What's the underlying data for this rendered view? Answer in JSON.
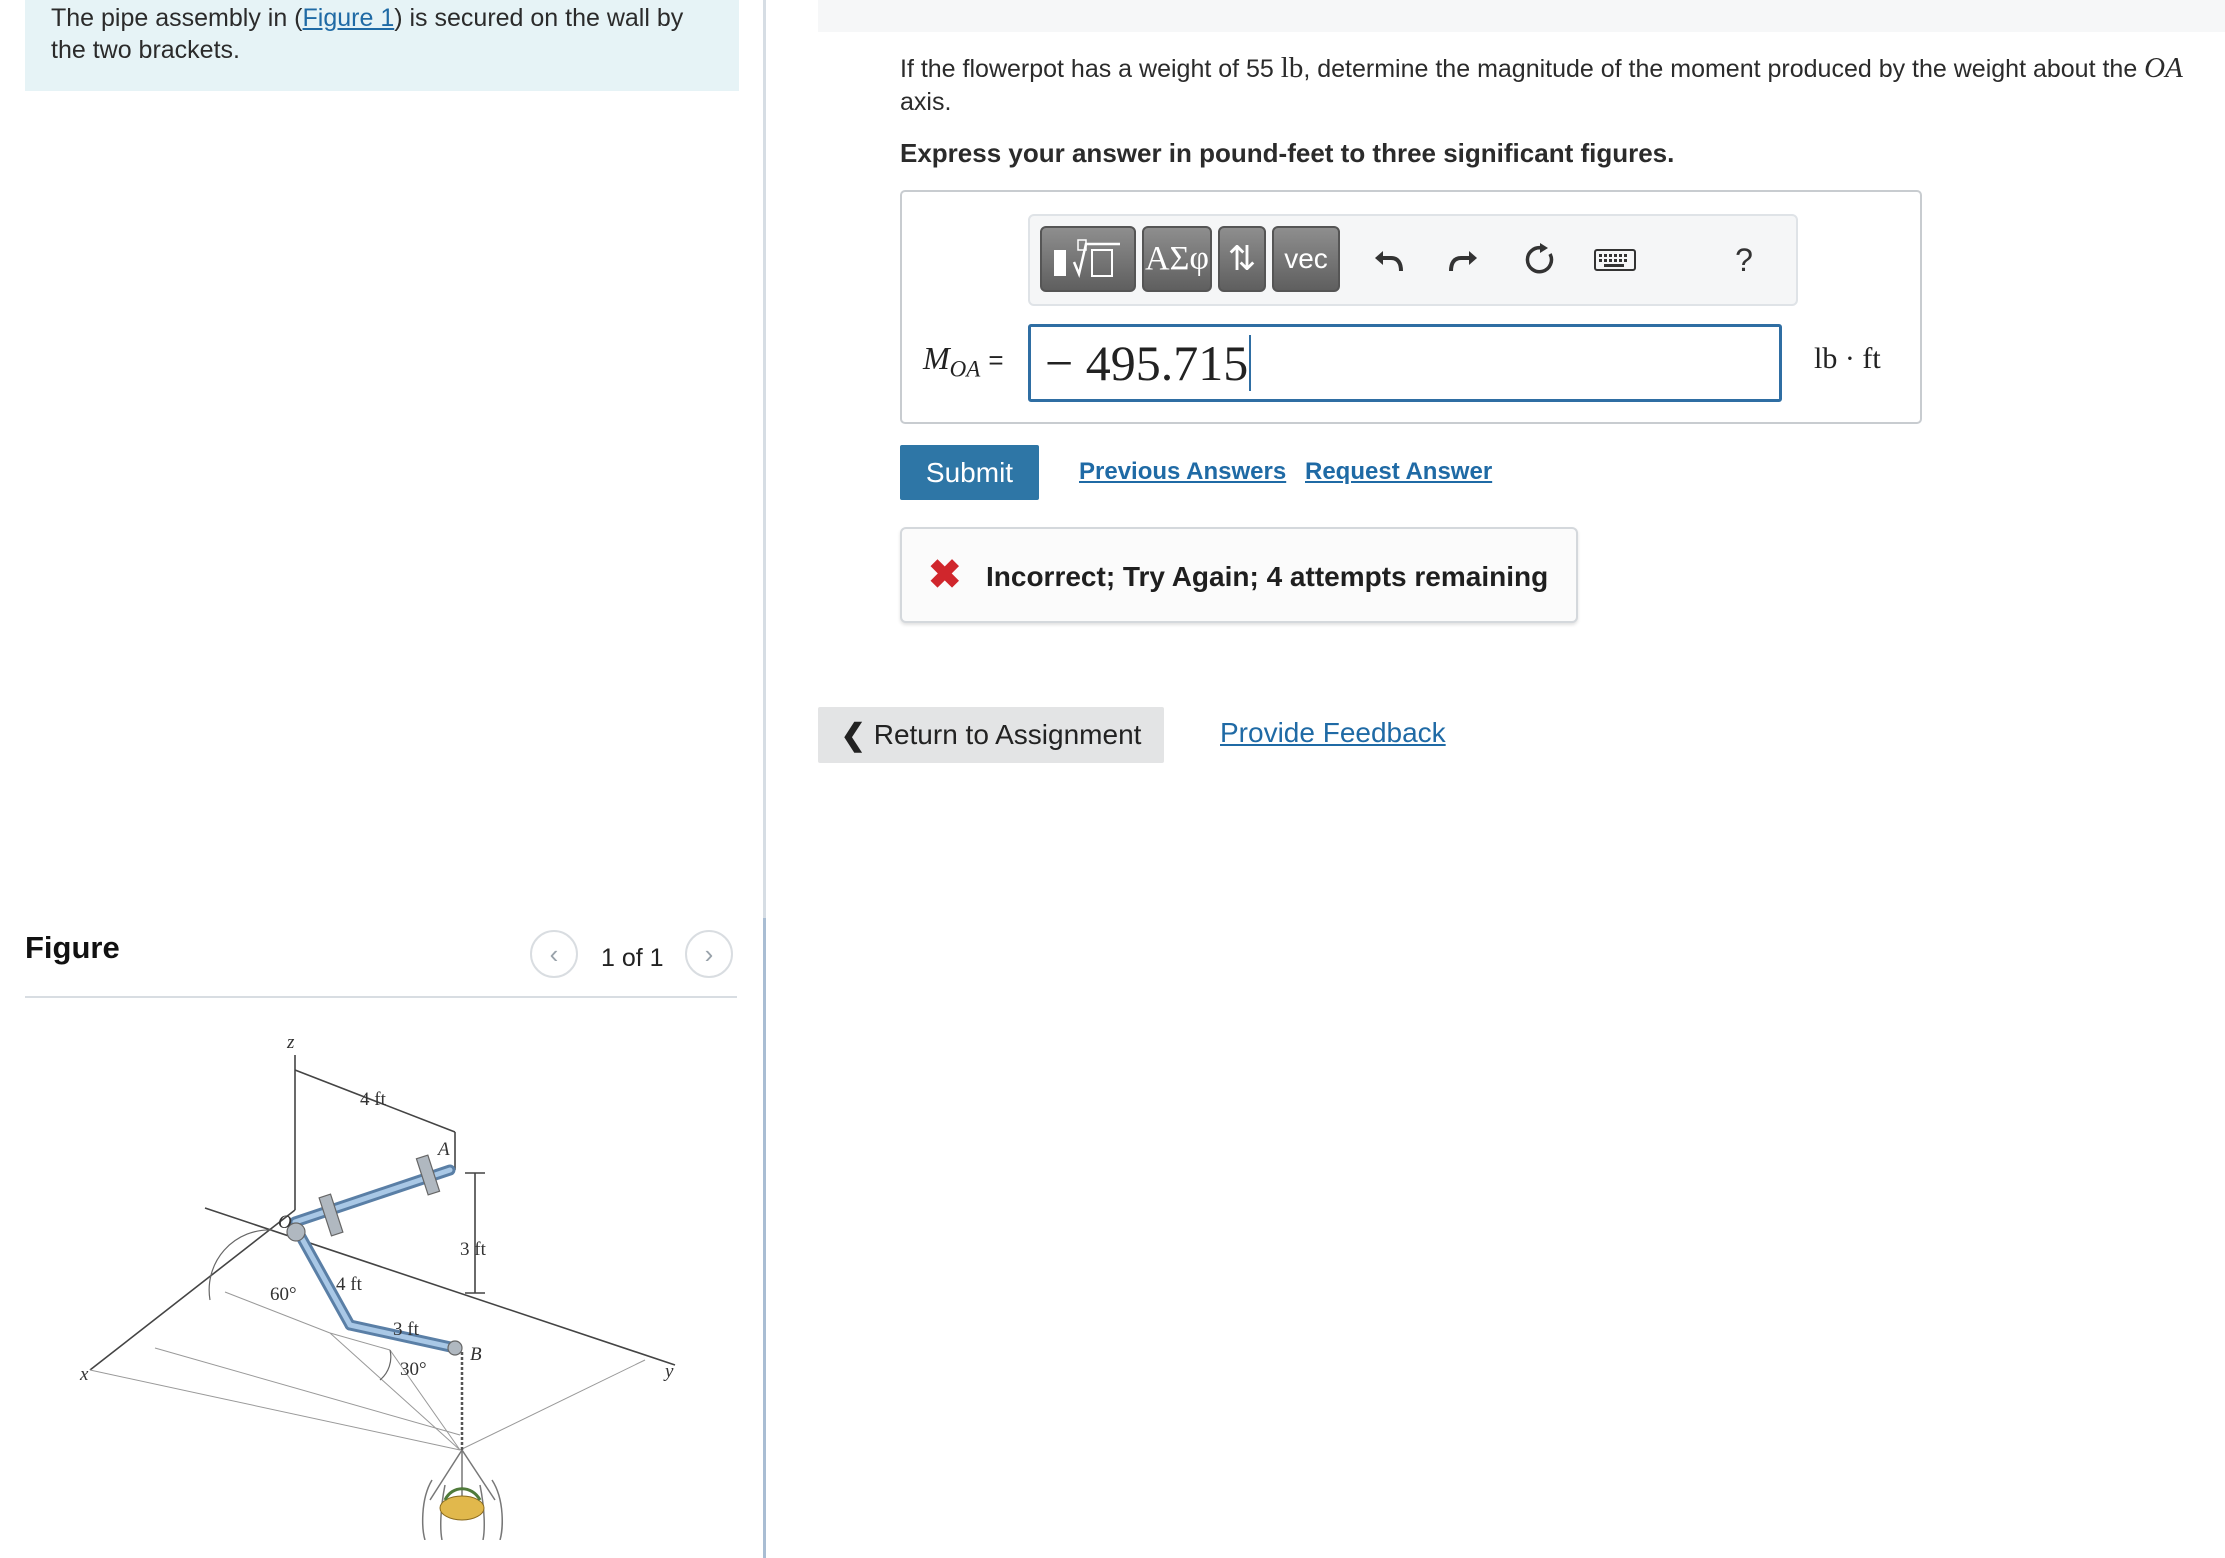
{
  "intro": {
    "text_before": "The pipe assembly in (",
    "figure_link": "Figure 1",
    "text_after": ") is secured on the wall by the two brackets."
  },
  "figure_panel": {
    "title": "Figure",
    "count": "1 of 1",
    "prev_icon": "chevron-left-icon",
    "next_icon": "chevron-right-icon",
    "labels": {
      "z": "z",
      "x": "x",
      "y": "y",
      "O": "O",
      "A": "A",
      "B": "B",
      "top_4ft": "4 ft",
      "side_3ft": "3 ft",
      "mid_4ft": "4 ft",
      "low_3ft": "3 ft",
      "angle_60": "60°",
      "angle_30": "30°"
    }
  },
  "question": {
    "part1": "If the flowerpot has a weight of 55 ",
    "unit_lb": "lb",
    "part2": ", determine the magnitude of the moment produced by the weight about the ",
    "axis": "OA",
    "part3": " axis.",
    "instruction": "Express your answer in pound-feet to three significant figures."
  },
  "toolbar": {
    "templates_icon": "templates-icon",
    "greek_label": "ΑΣφ",
    "arrows_label": "⇅",
    "vec_label": "vec",
    "undo_icon": "undo-icon",
    "redo_icon": "redo-icon",
    "reset_icon": "reset-icon",
    "keyboard_icon": "keyboard-icon",
    "help_label": "?"
  },
  "answer": {
    "variable": "M",
    "subscript": "OA",
    "equals": "=",
    "value": "− 495.715",
    "unit": "lb · ft"
  },
  "actions": {
    "submit_label": "Submit",
    "previous_answers": "Previous Answers",
    "request_answer": "Request Answer"
  },
  "feedback": {
    "message": "Incorrect; Try Again; 4 attempts remaining",
    "status_color": "#d0262c"
  },
  "footer": {
    "return_label": "Return to Assignment",
    "provide_feedback": "Provide Feedback"
  }
}
